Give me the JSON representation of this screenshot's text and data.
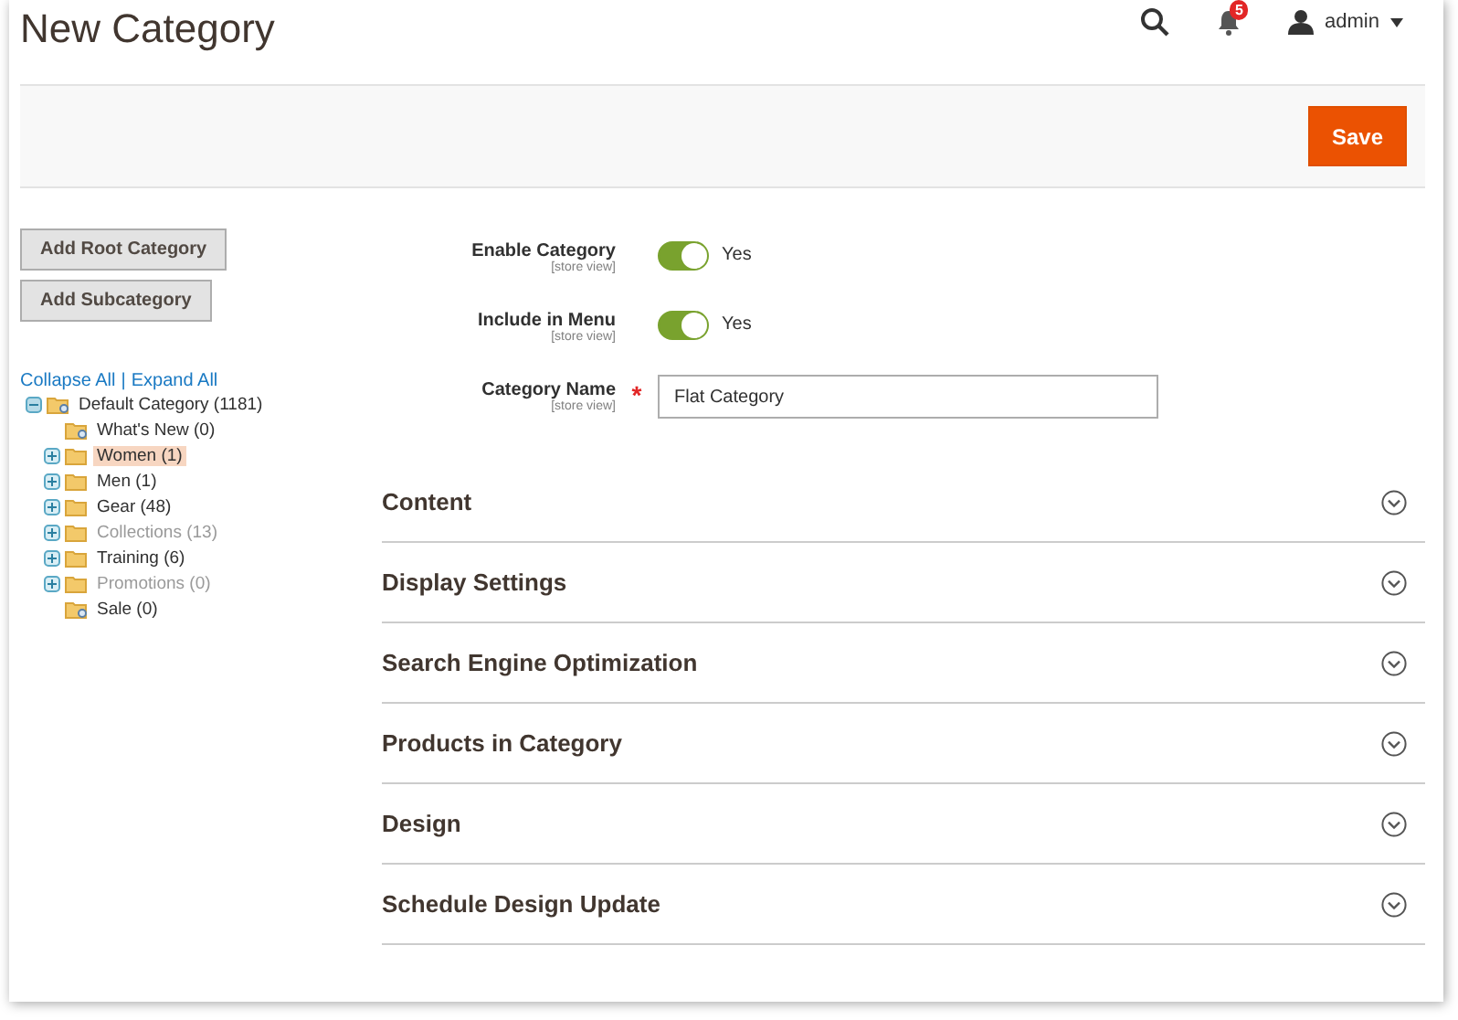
{
  "page_title": "New Category",
  "header": {
    "notification_count": "5",
    "user": "admin"
  },
  "actions": {
    "save": "Save"
  },
  "tree_buttons": [
    "Add Root Category",
    "Add Subcategory"
  ],
  "tree_links": {
    "collapse": "Collapse All",
    "separator": "|",
    "expand": "Expand All"
  },
  "tree": [
    {
      "label": "Default Category (1181)",
      "kind": "branch",
      "expanded": true,
      "selected": false,
      "disabled": false,
      "children": [
        {
          "label": "What's New (0)",
          "kind": "leaf",
          "selected": false,
          "disabled": false
        },
        {
          "label": "Women (1)",
          "kind": "branch",
          "expanded": false,
          "selected": true,
          "disabled": false
        },
        {
          "label": "Men (1)",
          "kind": "branch",
          "expanded": false,
          "selected": false,
          "disabled": false
        },
        {
          "label": "Gear (48)",
          "kind": "branch",
          "expanded": false,
          "selected": false,
          "disabled": false
        },
        {
          "label": "Collections (13)",
          "kind": "branch",
          "expanded": false,
          "selected": false,
          "disabled": true
        },
        {
          "label": "Training (6)",
          "kind": "branch",
          "expanded": false,
          "selected": false,
          "disabled": false
        },
        {
          "label": "Promotions (0)",
          "kind": "branch",
          "expanded": false,
          "selected": false,
          "disabled": true
        },
        {
          "label": "Sale (0)",
          "kind": "leaf",
          "selected": false,
          "disabled": false
        }
      ]
    }
  ],
  "fields": [
    {
      "kind": "toggle",
      "label": "Enable Category",
      "scope": "[store view]",
      "on": true,
      "value": "Yes"
    },
    {
      "kind": "toggle",
      "label": "Include in Menu",
      "scope": "[store view]",
      "on": true,
      "value": "Yes"
    },
    {
      "kind": "text",
      "label": "Category Name",
      "scope": "[store view]",
      "value": "Flat Category",
      "required": true,
      "required_mark": "*"
    }
  ],
  "sections": [
    {
      "title": "Content",
      "expanded": false
    },
    {
      "title": "Display Settings",
      "expanded": false
    },
    {
      "title": "Search Engine Optimization",
      "expanded": false
    },
    {
      "title": "Products in Category",
      "expanded": false
    },
    {
      "title": "Design",
      "expanded": false
    },
    {
      "title": "Schedule Design Update",
      "expanded": false
    }
  ]
}
